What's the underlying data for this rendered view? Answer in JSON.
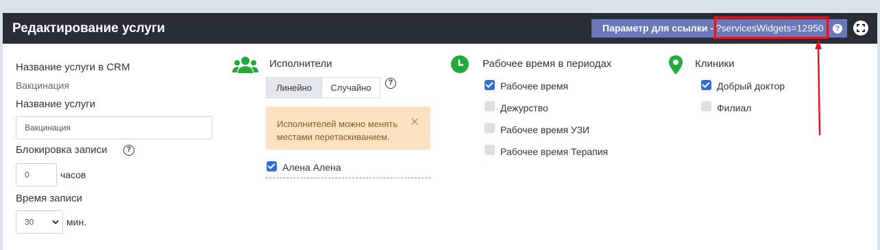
{
  "header": {
    "title": "Редактирование услуги",
    "param_label": "Параметр для ссылки - ",
    "param_value": "?servicesWidgets=12950"
  },
  "colors": {
    "header_bg": "#2a2d35",
    "accent": "#6a77b8",
    "green": "#22aa3c",
    "checkbox": "#2f6fd6",
    "annotation": "#e0161e"
  },
  "icons": [
    "help-icon",
    "fullscreen-icon",
    "users-icon",
    "clock-icon",
    "map-pin-icon"
  ],
  "form": {
    "crm_name_label": "Название услуги в CRM",
    "crm_name_value": "Вакцинация",
    "service_name_label": "Название услуги",
    "service_name_value": "Вакцинация",
    "block_label": "Блокировка записи",
    "block_value": "0",
    "block_unit": "часов",
    "duration_label": "Время записи",
    "duration_value": "30",
    "duration_unit": "мин."
  },
  "executors": {
    "title": "Исполнители",
    "mode_linear": "Линейно",
    "mode_random": "Случайно",
    "alert_text": "Исполнителей можно менять местами перетаскиванием.",
    "items": [
      {
        "label": "Алена Алена",
        "checked": true
      }
    ]
  },
  "work_time": {
    "title": "Рабочее время в периодах",
    "items": [
      {
        "label": "Рабочее время",
        "checked": true
      },
      {
        "label": "Дежурство",
        "checked": false
      },
      {
        "label": "Рабочее время УЗИ",
        "checked": false
      },
      {
        "label": "Рабочее время Терапия",
        "checked": false
      }
    ]
  },
  "clinics": {
    "title": "Клиники",
    "items": [
      {
        "label": "Добрый доктор",
        "checked": true
      },
      {
        "label": "Филиал",
        "checked": false
      }
    ]
  }
}
